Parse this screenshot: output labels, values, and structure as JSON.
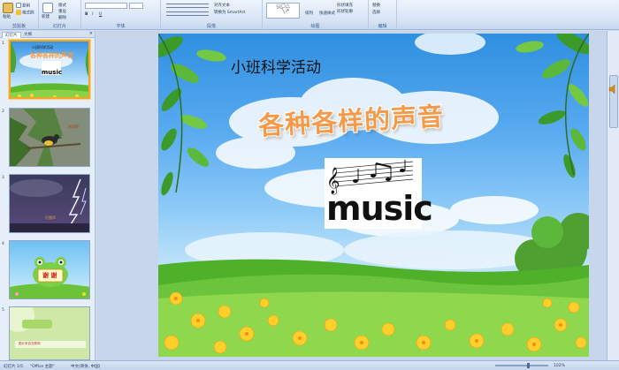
{
  "ribbon": {
    "groups": [
      {
        "label": "剪贴板",
        "buttons": [
          "粘贴",
          "复制",
          "格式刷"
        ]
      },
      {
        "label": "幻灯片",
        "buttons": [
          "新建",
          "重设",
          "删除"
        ]
      },
      {
        "label": "字体",
        "buttons": [
          "B",
          "I",
          "U"
        ]
      },
      {
        "label": "段落",
        "buttons": [
          "对齐文本",
          "转换为 SmartArt"
        ]
      },
      {
        "label": "绘图",
        "buttons": [
          "排列",
          "快速样式",
          "形状填充",
          "形状轮廓"
        ]
      },
      {
        "label": "编辑",
        "buttons": [
          "替换",
          "选择"
        ]
      }
    ],
    "new_slide_label": "新建",
    "layout_label": "版式"
  },
  "panel": {
    "tabs": [
      "幻灯片",
      "大纲"
    ],
    "close": "×",
    "slide_numbers": [
      "1",
      "2",
      "3",
      "4",
      "5"
    ]
  },
  "thumbnails": {
    "t1_title": "小班科学活动",
    "t1_heading": "各种各样的声音",
    "t1_music": "music",
    "t4_text": "谢 谢",
    "t5_text": "图片来自互联网"
  },
  "slide": {
    "title": "小班科学活动",
    "heading": "各种各样的声音",
    "music_word": "music"
  },
  "status": {
    "slide_count": "幻灯片 1/5",
    "theme": "\"Office 主题\"",
    "language": "中文(简体, 中国)",
    "zoom": "102%"
  },
  "colors": {
    "heading_orange": "#f49a4a",
    "sky_blue": "#58aaf0",
    "grass_green": "#5cb82e",
    "selection_orange": "#f5a623"
  }
}
